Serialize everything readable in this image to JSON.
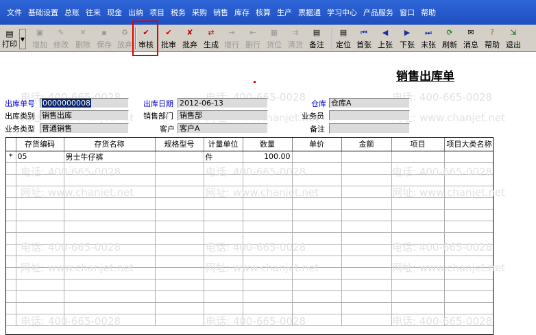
{
  "menu": [
    "文件",
    "基础设置",
    "总账",
    "往来",
    "现金",
    "出纳",
    "项目",
    "税务",
    "采购",
    "销售",
    "库存",
    "核算",
    "生产",
    "票据通",
    "学习中心",
    "产品服务",
    "窗口",
    "帮助"
  ],
  "toolbar": {
    "print_label": "打印",
    "add_label": "增加",
    "modify_label": "修改",
    "delete_label": "删除",
    "save_label": "保存",
    "abandon_label": "放弃",
    "audit_label": "审核",
    "approve_label": "批审",
    "batch_abandon_label": "批弃",
    "generate_label": "生成",
    "add_row_label": "增行",
    "delete_row_label": "删行",
    "location_label": "货位",
    "clear_label": "清货",
    "remark_label": "备注",
    "locate_label": "定位",
    "first_label": "首张",
    "prev_label": "上张",
    "next_label": "下张",
    "last_label": "末张",
    "refresh_label": "刷新",
    "message_label": "消息",
    "help_label": "帮助",
    "exit_label": "退出"
  },
  "form": {
    "title": "销售出库单",
    "outbound_no_label": "出库单号",
    "outbound_no_value": "0000000008",
    "outbound_date_label": "出库日期",
    "outbound_date_value": "2012-06-13",
    "warehouse_label": "仓库",
    "warehouse_value": "仓库A",
    "outbound_type_label": "出库类别",
    "outbound_type_value": "销售出库",
    "sales_dept_label": "销售部门",
    "sales_dept_value": "销售部",
    "salesperson_label": "业务员",
    "salesperson_value": "",
    "business_type_label": "业务类型",
    "business_type_value": "普通销售",
    "customer_label": "客户",
    "customer_value": "客户A",
    "remark_label": "备注",
    "remark_value": ""
  },
  "grid": {
    "columns": [
      "",
      "存货编码",
      "存货名称",
      "规格型号",
      "计量单位",
      "数量",
      "单价",
      "金额",
      "项目",
      "项目大类名称"
    ],
    "rows": [
      {
        "mark": "*",
        "code": "05",
        "name": "男士牛仔裤",
        "spec": "",
        "unit": "件",
        "qty": "100.00",
        "price": "",
        "amount": "",
        "project": "",
        "project_cat": ""
      }
    ]
  },
  "watermark": {
    "phone": "电话: 400-665-0028",
    "site": "网址: www.chanjet.net"
  }
}
